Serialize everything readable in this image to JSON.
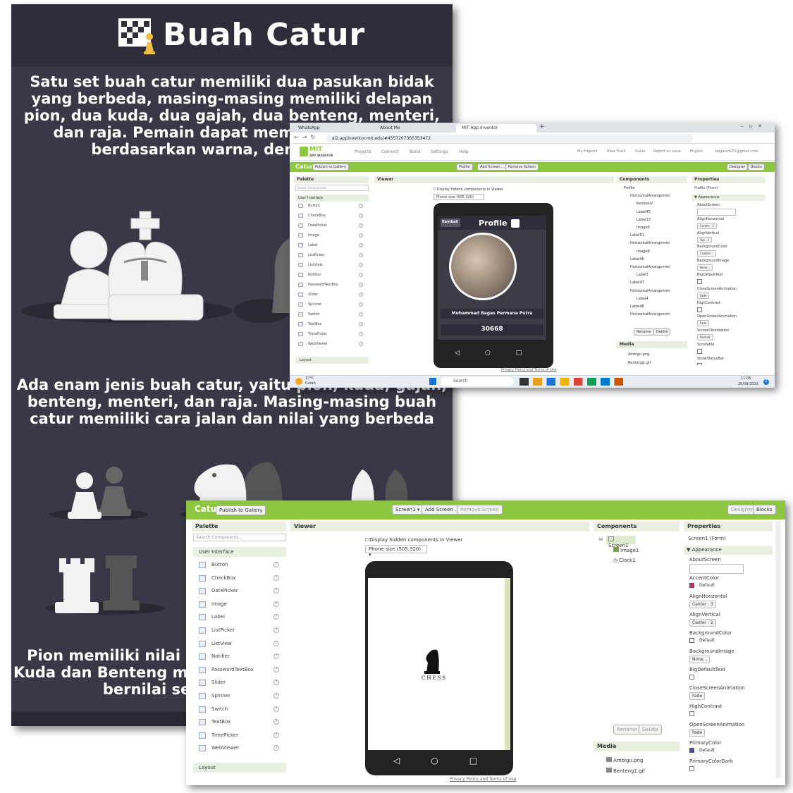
{
  "poster": {
    "title": "Buah Catur",
    "para1": "Satu set buah catur memiliki dua pasukan bidak yang berbeda, masing-masing memiliki delapan pion, dua kuda, dua gajah, dua benteng, menteri, dan raja. Pemain dapat membedakan pasu berdasarkan warna, dengan warn",
    "para2": "Ada enam jenis buah catur, yaitu pion, kuda, gajah, benteng, menteri, dan raja. Masing-masing buah catur memiliki cara jalan dan nilai yang berbeda",
    "para3": "Pion memiliki nilai s perwira. Kuda dan Benteng memiliki nil bernilai sembilan. B",
    "colors": {
      "bg": "#3a3846",
      "header": "#2f2d39",
      "text": "#ffffff"
    }
  },
  "window_small": {
    "tabs": [
      "WhatsApp",
      "About Me",
      "MIT App Inventor"
    ],
    "url": "ai2.appinventor.mit.edu/#4557207365353472",
    "brand_top": "MIT",
    "brand_bottom": "APP INVENTOR",
    "menu": [
      "Projects",
      "Connect",
      "Build",
      "Settings",
      "Help"
    ],
    "right_menu": [
      "My Projects",
      "View Trash",
      "Guide",
      "Report an Issue",
      "English",
      "bagasm072@gmail.com"
    ],
    "project_name": "Catur",
    "publish_label": "Publish to Gallery",
    "screen_select": "Profile",
    "add_screen": "Add Screen ...",
    "remove_screen": "Remove Screen",
    "designer": "Designer",
    "blocks": "Blocks",
    "palette": "Palette",
    "search_placeholder": "Search Components",
    "user_interface": "User Interface",
    "palette_items": [
      "Button",
      "CheckBox",
      "DatePicker",
      "Image",
      "Label",
      "ListPicker",
      "ListView",
      "Notifier",
      "PasswordTextBox",
      "Slider",
      "Spinner",
      "Switch",
      "TextBox",
      "TimePicker",
      "WebViewer"
    ],
    "layout": "Layout",
    "viewer": "Viewer",
    "display_hidden": "Display hidden components in Viewer",
    "phone_size": "Phone size (505,320)",
    "app_back": "Kembali",
    "app_title": "Profile",
    "app_name": "Muhammad Bagas Permana Putra",
    "app_number": "30668",
    "components": "Components",
    "tree": [
      "Profile",
      "HorizontalArrangemen",
      "Kembali2",
      "Label45",
      "Label13",
      "Image5",
      "Label51",
      "HorizontalArrangemen",
      "Image8",
      "Label46",
      "HorizontalArrangemen",
      "Label3",
      "Label47",
      "HorizontalArrangemen",
      "Label4",
      "Label48",
      "HorizontalArrangemen"
    ],
    "rename": "Rename",
    "delete": "Delete",
    "media": "Media",
    "media_items": [
      "Ambigu.png",
      "Benteng1.gif"
    ],
    "properties": "Properties",
    "prop_screen": "Profile (Form)",
    "appearance": "Appearance",
    "props": [
      {
        "label": "AboutScreen"
      },
      {
        "label": "AlignHorizontal",
        "value": "Center : 3"
      },
      {
        "label": "AlignVertical",
        "value": "Top : 1"
      },
      {
        "label": "BackgroundColor",
        "value": "Custom..."
      },
      {
        "label": "BackgroundImage",
        "value": "None..."
      },
      {
        "label": "BigDefaultText"
      },
      {
        "label": "CloseScreenAnimation",
        "value": "Fade"
      },
      {
        "label": "HighContrast"
      },
      {
        "label": "OpenScreenAnimation",
        "value": "Fade"
      },
      {
        "label": "ScreenOrientation",
        "value": "Portrait"
      },
      {
        "label": "Scrollable"
      },
      {
        "label": "ShowStatusBar"
      }
    ],
    "privacy": "Privacy Policy and Terms of Use",
    "weather_temp": "17°C",
    "weather_text": "Cerah",
    "search": "Search",
    "time": "11:05",
    "date": "20/09/2023",
    "notif": "2"
  },
  "window_large": {
    "project_name": "Catur",
    "publish_label": "Publish to Gallery",
    "screen_select": "Screen1",
    "add_screen": "Add Screen ...",
    "remove_screen": "Remove Screen",
    "designer": "Designer",
    "blocks": "Blocks",
    "palette": "Palette",
    "search_placeholder": "Search Components...",
    "user_interface": "User Interface",
    "palette_items": [
      "Button",
      "CheckBox",
      "DatePicker",
      "Image",
      "Label",
      "ListPicker",
      "ListView",
      "Notifier",
      "PasswordTextBox",
      "Slider",
      "Spinner",
      "Switch",
      "TextBox",
      "TimePicker",
      "WebViewer"
    ],
    "layout": "Layout",
    "viewer": "Viewer",
    "display_hidden": "Display hidden components in Viewer",
    "phone_size": "Phone size (505,320)",
    "chess_text": "CHESS",
    "components": "Components",
    "tree": [
      "Screen1",
      "Image1",
      "Clock1"
    ],
    "rename": "Rename",
    "delete": "Delete",
    "media": "Media",
    "media_items": [
      "Ambigu.png",
      "Benteng1.gif"
    ],
    "properties": "Properties",
    "prop_screen": "Screen1 (Form)",
    "appearance": "Appearance",
    "props": [
      {
        "label": "AboutScreen"
      },
      {
        "label": "AccentColor",
        "value": "Default",
        "color": "#e91e63"
      },
      {
        "label": "AlignHorizontal",
        "value": "Center : 3"
      },
      {
        "label": "AlignVertical",
        "value": "Center : 2"
      },
      {
        "label": "BackgroundColor",
        "value": "Default",
        "color": "#ffffff"
      },
      {
        "label": "BackgroundImage",
        "value": "None..."
      },
      {
        "label": "BigDefaultText"
      },
      {
        "label": "CloseScreenAnimation",
        "value": "Fade"
      },
      {
        "label": "HighContrast"
      },
      {
        "label": "OpenScreenAnimation",
        "value": "Fade"
      },
      {
        "label": "PrimaryColor",
        "value": "Default",
        "color": "#3f51b5"
      },
      {
        "label": "PrimaryColorDark"
      }
    ],
    "privacy": "Privacy Policy and Terms of Use",
    "accent_green": "#8dc63f"
  }
}
